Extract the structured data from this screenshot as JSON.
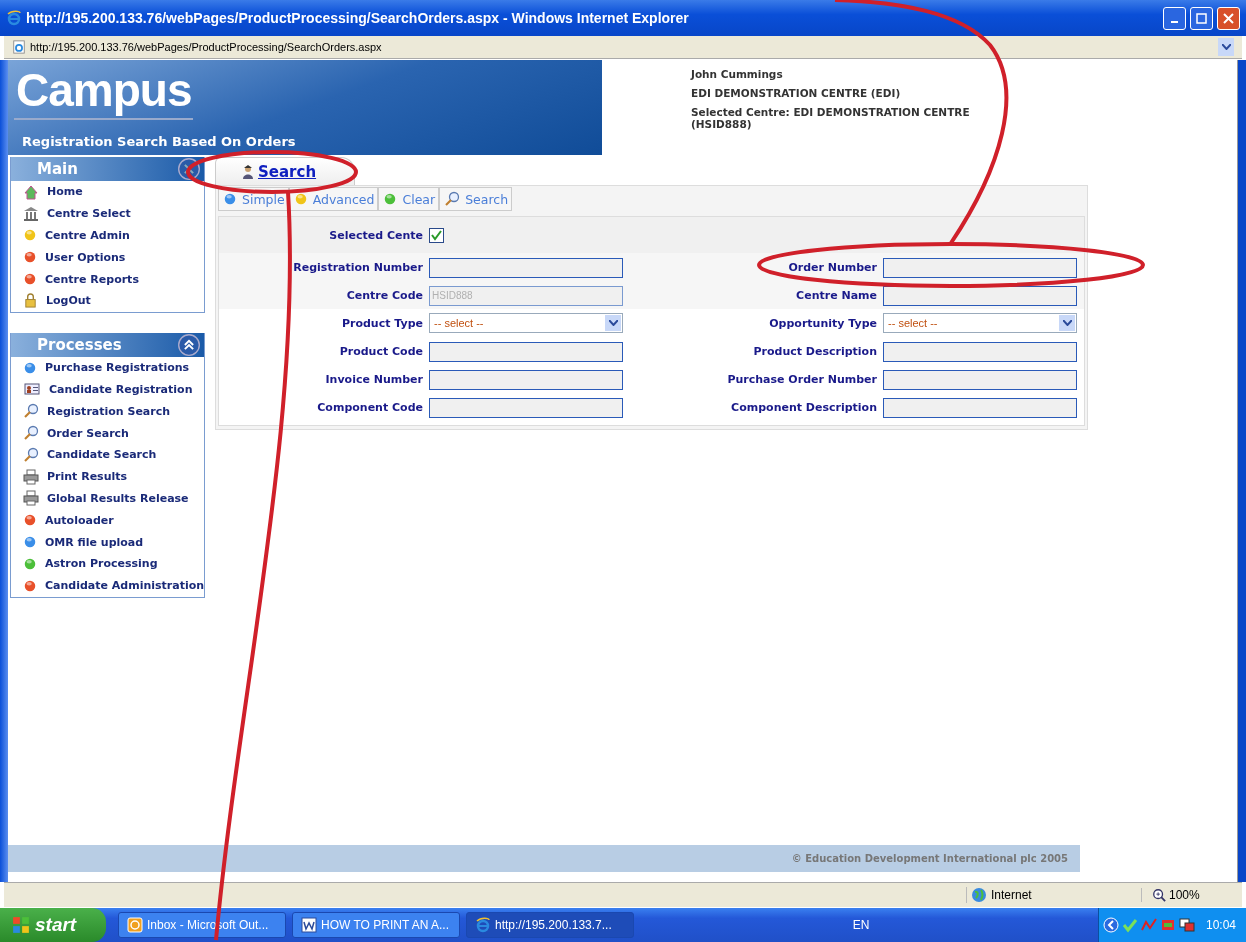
{
  "window": {
    "title": "http://195.200.133.76/webPages/ProductProcessing/SearchOrders.aspx - Windows Internet Explorer"
  },
  "address_bar": {
    "url": "http://195.200.133.76/webPages/ProductProcessing/SearchOrders.aspx"
  },
  "header": {
    "logo": "Campus",
    "subtitle": "Registration Search Based On Orders",
    "user": "John Cummings",
    "centre": "EDI DEMONSTRATION CENTRE (EDI)",
    "selected_centre": "Selected Centre: EDI DEMONSTRATION CENTRE (HSID888)"
  },
  "sidebar": {
    "sections": [
      {
        "title": "Main",
        "kind": "collapse",
        "items": [
          {
            "label": "Home",
            "kind": "home"
          },
          {
            "label": "Centre Select",
            "kind": "building"
          },
          {
            "label": "Centre Admin",
            "kind": "dot",
            "color": "#f0c419"
          },
          {
            "label": "User Options",
            "kind": "dot",
            "color": "#e8502a"
          },
          {
            "label": "Centre Reports",
            "kind": "dot",
            "color": "#e8502a"
          },
          {
            "label": "LogOut",
            "kind": "lock"
          }
        ]
      },
      {
        "title": "Processes",
        "kind": "chevron",
        "items": [
          {
            "label": "Purchase Registrations",
            "kind": "dot",
            "color": "#3a8ee8"
          },
          {
            "label": "Candidate Registration",
            "kind": "card"
          },
          {
            "label": "Registration Search",
            "kind": "magnifier"
          },
          {
            "label": "Order Search",
            "kind": "magnifier"
          },
          {
            "label": "Candidate Search",
            "kind": "magnifier"
          },
          {
            "label": "Print Results",
            "kind": "printer"
          },
          {
            "label": "Global Results Release",
            "kind": "printer"
          },
          {
            "label": "Autoloader",
            "kind": "dot",
            "color": "#e8502a"
          },
          {
            "label": "OMR file upload",
            "kind": "dot",
            "color": "#3a8ee8"
          },
          {
            "label": "Astron Processing",
            "kind": "dot",
            "color": "#4cbf3a"
          },
          {
            "label": "Candidate Administration",
            "kind": "dot",
            "color": "#e8502a"
          }
        ]
      }
    ]
  },
  "tabs": [
    {
      "label": "Search",
      "selected": true
    }
  ],
  "toolbar": [
    {
      "label": "Simple",
      "kind": "dot",
      "color": "#3a8ee8"
    },
    {
      "label": "Advanced",
      "kind": "dot",
      "color": "#f0c419"
    },
    {
      "label": "Clear",
      "kind": "dot",
      "color": "#4cbf3a"
    },
    {
      "label": "Search",
      "kind": "magnifier"
    }
  ],
  "form": {
    "rows": [
      {
        "shaded": true,
        "fields": [
          {
            "label": "Selected Cente",
            "kind": "checkbox",
            "checked": true
          }
        ]
      },
      {
        "shaded": true,
        "fields": [
          {
            "label": "Registration Number",
            "kind": "text"
          },
          {
            "label": "Order Number",
            "kind": "text"
          }
        ]
      },
      {
        "shaded": true,
        "fields": [
          {
            "label": "Centre Code",
            "kind": "text",
            "value": "HSID888",
            "disabled": true
          },
          {
            "label": "Centre Name",
            "kind": "text"
          }
        ]
      },
      {
        "shaded": false,
        "fields": [
          {
            "label": "Product Type",
            "kind": "select",
            "value": "-- select --"
          },
          {
            "label": "Opportunity Type",
            "kind": "select",
            "value": "-- select --"
          }
        ]
      },
      {
        "shaded": false,
        "fields": [
          {
            "label": "Product Code",
            "kind": "text"
          },
          {
            "label": "Product Description",
            "kind": "text"
          }
        ]
      },
      {
        "shaded": false,
        "fields": [
          {
            "label": "Invoice Number",
            "kind": "text"
          },
          {
            "label": "Purchase Order Number",
            "kind": "text"
          }
        ]
      },
      {
        "shaded": false,
        "fields": [
          {
            "label": "Component Code",
            "kind": "text"
          },
          {
            "label": "Component Description",
            "kind": "text"
          }
        ]
      }
    ]
  },
  "footer": {
    "copyright": "© Education Development International plc 2005"
  },
  "status_bar": {
    "zone": "Internet",
    "zoom": "100%"
  },
  "taskbar": {
    "start": "start",
    "tasks": [
      {
        "label": "Inbox - Microsoft Out...",
        "kind": "outlook",
        "selected": false
      },
      {
        "label": "HOW TO PRINT AN A...",
        "kind": "word",
        "selected": false
      },
      {
        "label": "http://195.200.133.7...",
        "kind": "ie",
        "selected": true
      }
    ],
    "language": "EN",
    "clock": "10:04"
  }
}
